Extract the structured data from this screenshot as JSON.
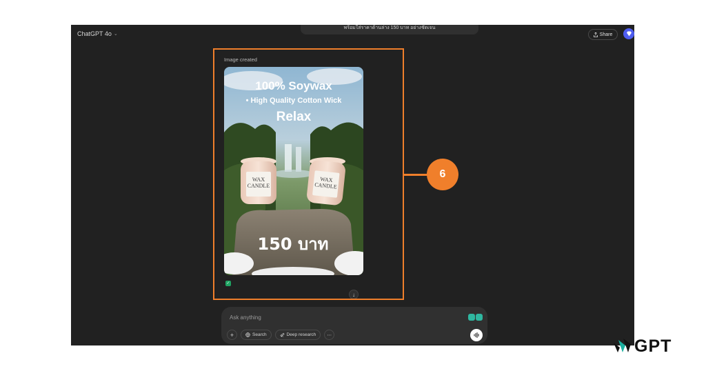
{
  "header": {
    "model_name": "ChatGPT 4o",
    "prompt_text": "พร้อมใส่ราคาด้านล่าง 150 บาท อย่างชัดเจน",
    "share_label": "Share"
  },
  "message": {
    "image_created_label": "Image created",
    "image": {
      "headline": "100% Soywax",
      "subline": "• High Quality Cotton Wick",
      "tagline": "Relax",
      "brand_line1": "WAX",
      "brand_line2": "CANDLE",
      "price": "150 บาท"
    }
  },
  "composer": {
    "placeholder": "Ask anything",
    "tools": [
      {
        "icon": "globe-icon",
        "label": "Search"
      },
      {
        "icon": "telescope-icon",
        "label": "Deep research"
      }
    ]
  },
  "annotation": {
    "step_number": "6",
    "color": "#f07f2b"
  },
  "watermark": {
    "text": "GPT"
  },
  "colors": {
    "app_bg": "#212121",
    "surface": "#303030",
    "accent_avatar": "#4f5df0",
    "check_green": "#1fa463"
  }
}
